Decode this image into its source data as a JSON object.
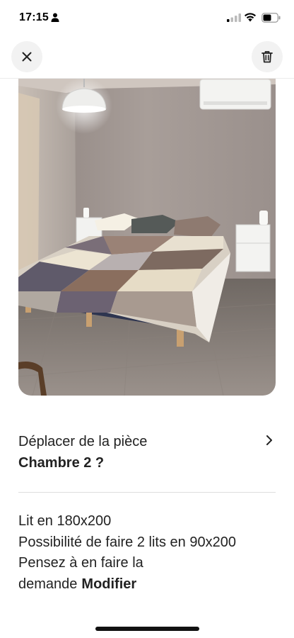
{
  "status_bar": {
    "time": "17:15"
  },
  "header": {
    "close_icon": "close-icon",
    "delete_icon": "trash-icon"
  },
  "photo": {
    "subject": "bedroom-photo"
  },
  "move_room": {
    "line1": "Déplacer de la pièce",
    "room_name": "Chambre 2 ?"
  },
  "description": {
    "lines": [
      "Lit en 180x200",
      "Possibilité de faire 2 lits en 90x200",
      "Pensez à en faire la"
    ],
    "last_line_prefix": "demande",
    "edit_label": "Modifier"
  },
  "colors": {
    "text": "#222222",
    "divider": "#dddddd",
    "button_bg": "#f2f2f2"
  }
}
